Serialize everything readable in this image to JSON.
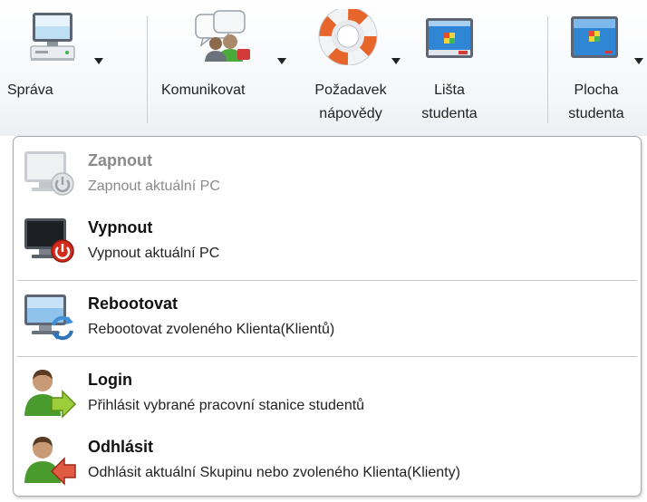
{
  "toolbar": {
    "sprava": "Správa",
    "komunikovat": "Komunikovat",
    "pozadavek_line1": "Požadavek",
    "pozadavek_line2": "nápovědy",
    "lista_line1": "Lišta",
    "lista_line2": "studenta",
    "plocha_line1": "Plocha",
    "plocha_line2": "studenta"
  },
  "menu": {
    "items": [
      {
        "title": "Zapnout",
        "desc": "Zapnout aktuální PC",
        "enabled": false,
        "icon": "power-on-icon"
      },
      {
        "title": "Vypnout",
        "desc": "Vypnout aktuální PC",
        "enabled": true,
        "icon": "shutdown-icon"
      },
      {
        "title": "Rebootovat",
        "desc": "Rebootovat zvoleného Klienta(Klientů)",
        "enabled": true,
        "icon": "reboot-icon"
      },
      {
        "title": "Login",
        "desc": "Přihlásit vybrané pracovní stanice studentů",
        "enabled": true,
        "icon": "login-icon"
      },
      {
        "title": "Odhlásit",
        "desc": "Odhlásit aktuální Skupinu nebo zvoleného Klienta(Klienty)",
        "enabled": true,
        "icon": "logout-icon"
      }
    ]
  },
  "colors": {
    "power_red": "#d42a1a",
    "login_green": "#56b028",
    "logout_red": "#d63b2a",
    "screen_blue": "#3f8ed8"
  }
}
